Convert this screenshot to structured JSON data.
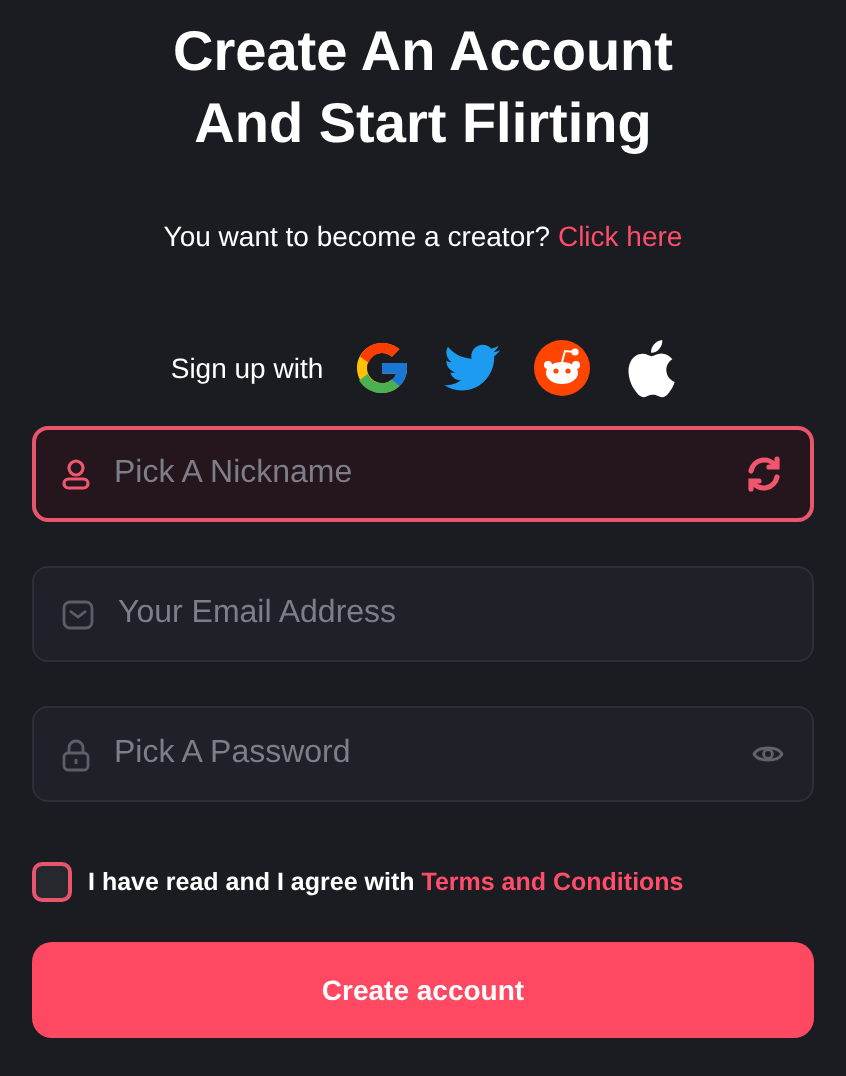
{
  "title_lines": [
    "Create An Account",
    "And Start Flirting"
  ],
  "creator_prompt": {
    "text": "You want to become a creator?",
    "link": "Click here"
  },
  "social": {
    "label": "Sign up with"
  },
  "fields": [
    {
      "kind": "nickname",
      "placeholder": "Pick A Nickname",
      "focused": true
    },
    {
      "kind": "email",
      "placeholder": "Your Email Address",
      "focused": false
    },
    {
      "kind": "password",
      "placeholder": "Pick A Password",
      "focused": false
    }
  ],
  "agreement": {
    "text": "I have read and I agree with",
    "link": "Terms and Conditions",
    "checked": false
  },
  "submit": {
    "label": "Create account"
  }
}
